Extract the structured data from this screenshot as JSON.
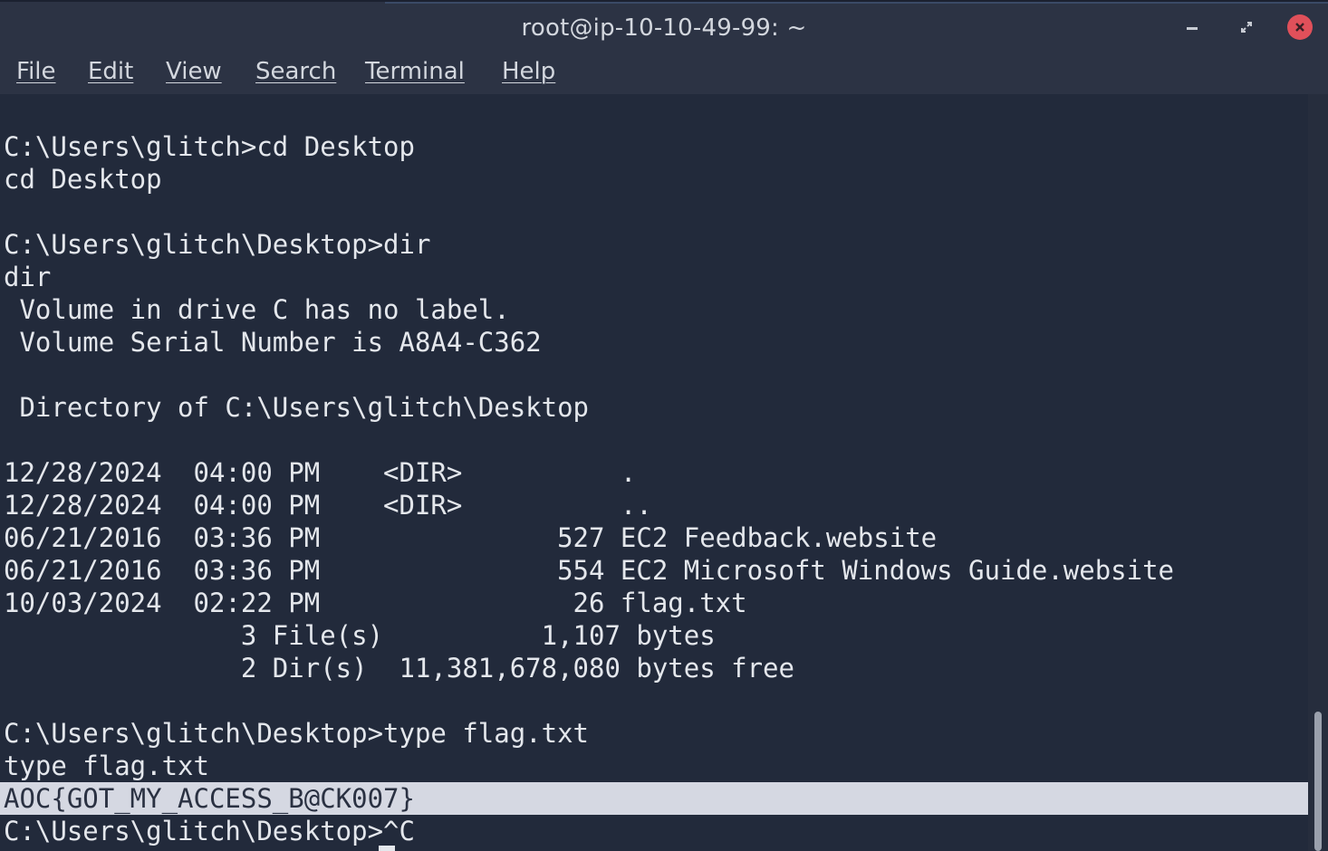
{
  "window": {
    "title": "root@ip-10-10-49-99: ~"
  },
  "menu": {
    "file": "File",
    "edit": "Edit",
    "view": "View",
    "search": "Search",
    "terminal": "Terminal",
    "help": "Help"
  },
  "terminal": {
    "lines": [
      "C:\\Users\\glitch>cd Desktop",
      "cd Desktop",
      "",
      "C:\\Users\\glitch\\Desktop>dir",
      "dir",
      " Volume in drive C has no label.",
      " Volume Serial Number is A8A4-C362",
      "",
      " Directory of C:\\Users\\glitch\\Desktop",
      "",
      "12/28/2024  04:00 PM    <DIR>          .",
      "12/28/2024  04:00 PM    <DIR>          ..",
      "06/21/2016  03:36 PM               527 EC2 Feedback.website",
      "06/21/2016  03:36 PM               554 EC2 Microsoft Windows Guide.website",
      "10/03/2024  02:22 PM                26 flag.txt",
      "               3 File(s)          1,107 bytes",
      "               2 Dir(s)  11,381,678,080 bytes free",
      "",
      "C:\\Users\\glitch\\Desktop>type flag.txt",
      "type flag.txt",
      "AOC{GOT_MY_ACCESS_B@CK007}",
      "C:\\Users\\glitch\\Desktop>^C"
    ]
  },
  "icons": {
    "minimize": "minimize-icon",
    "maximize": "restore-icon",
    "close": "close-icon"
  },
  "colors": {
    "background": "#222a3b",
    "titlebar": "#2c3344",
    "text": "#e4e7ec",
    "highlight": "#d5d8e2",
    "close": "#e0505a"
  }
}
